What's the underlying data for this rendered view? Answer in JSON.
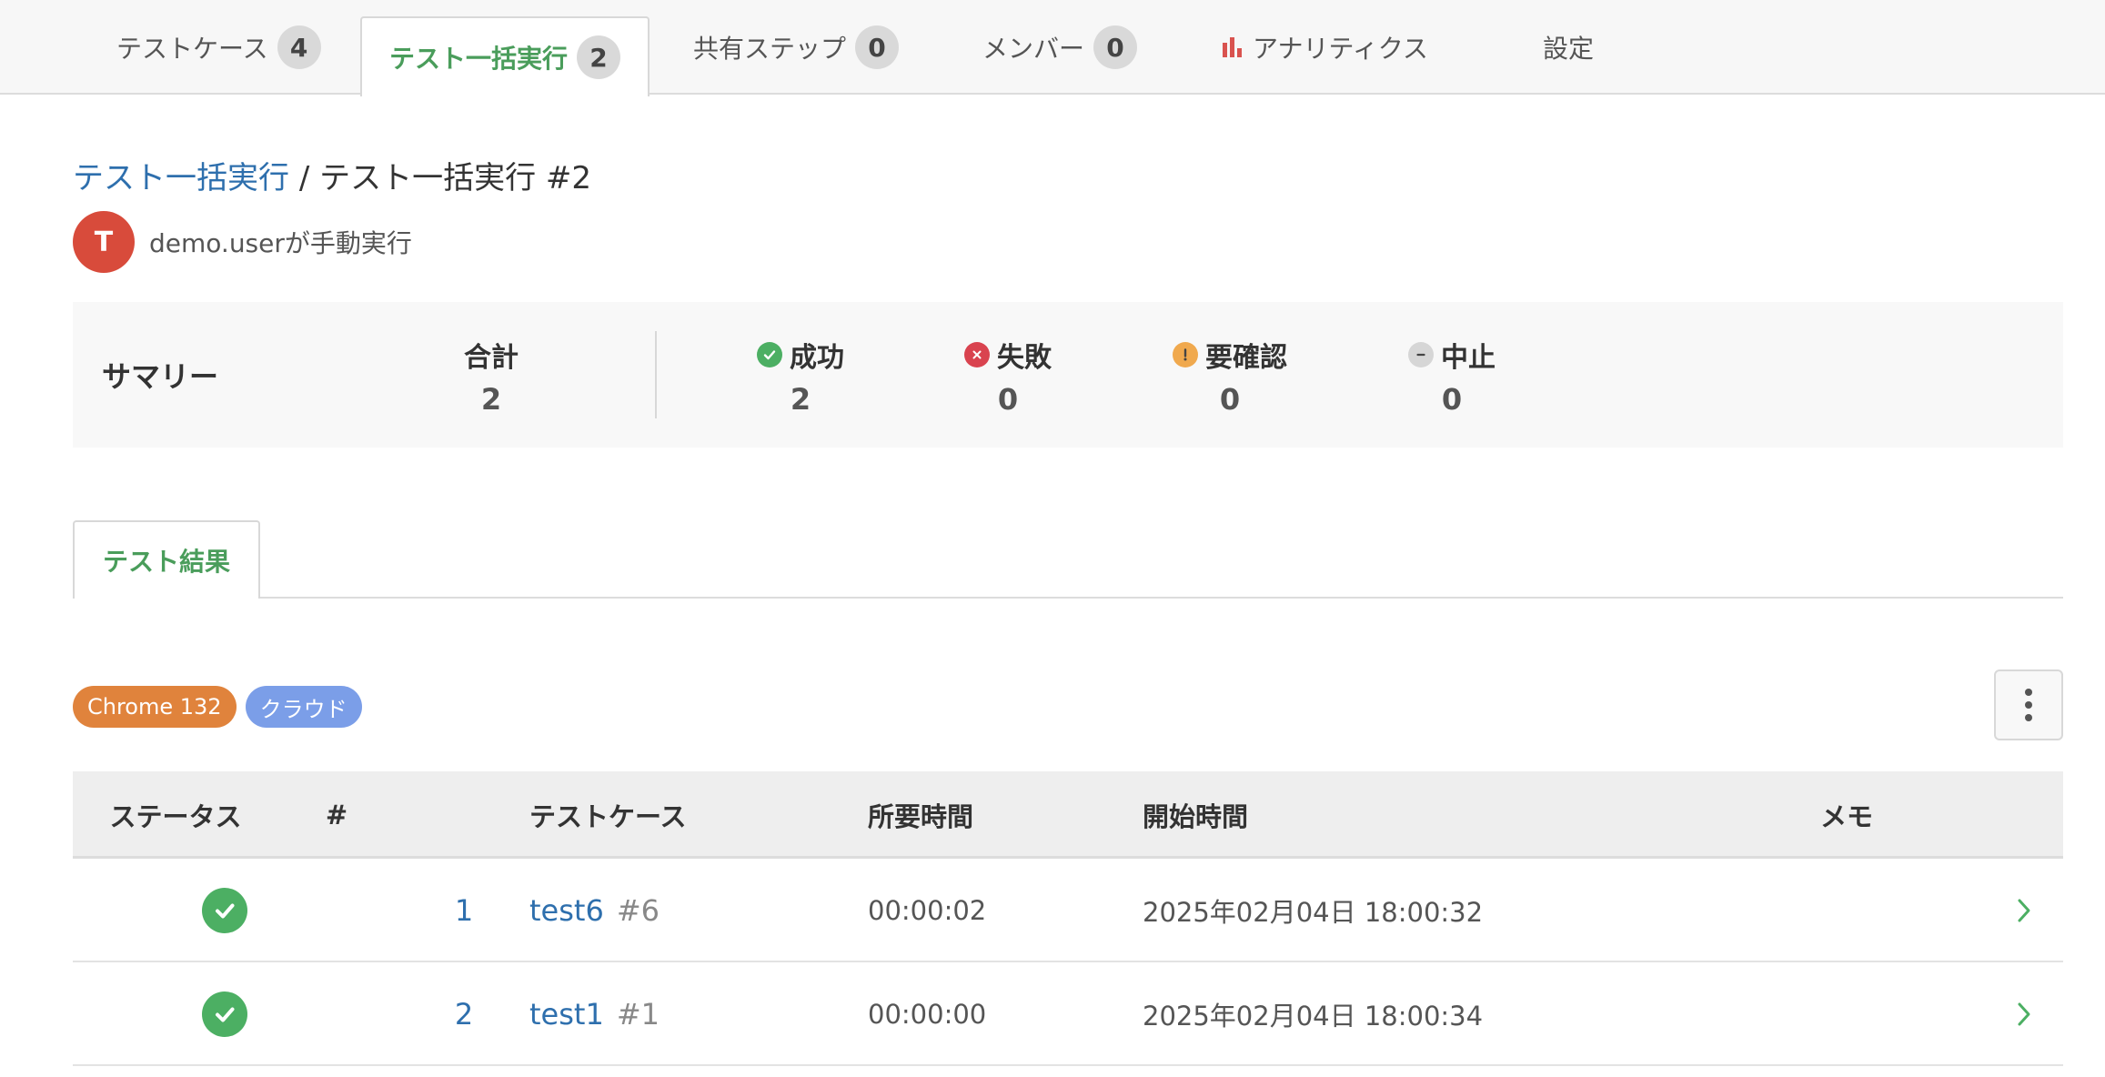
{
  "top_tabs": [
    {
      "label": "テストケース",
      "count": "4"
    },
    {
      "label": "テスト一括実行",
      "count": "2"
    },
    {
      "label": "共有ステップ",
      "count": "0"
    },
    {
      "label": "メンバー",
      "count": "0"
    },
    {
      "label": "アナリティクス",
      "icon": "bar-chart-icon"
    },
    {
      "label": "設定"
    }
  ],
  "breadcrumb": {
    "parent": "テスト一括実行",
    "separator": "/",
    "current": "テスト一括実行 #2"
  },
  "runner": {
    "avatar_initial": "T",
    "text": "demo.userが手動実行"
  },
  "summary": {
    "title": "サマリー",
    "total": {
      "label": "合計",
      "value": "2"
    },
    "success": {
      "label": "成功",
      "value": "2",
      "icon": "check-circle-icon"
    },
    "failed": {
      "label": "失敗",
      "value": "0",
      "icon": "x-circle-icon"
    },
    "review": {
      "label": "要確認",
      "value": "0",
      "icon": "exclamation-circle-icon"
    },
    "aborted": {
      "label": "中止",
      "value": "0",
      "icon": "minus-circle-icon"
    }
  },
  "results_tab": {
    "label": "テスト結果"
  },
  "tags": {
    "browser": "Chrome 132",
    "environment": "クラウド"
  },
  "table": {
    "headers": {
      "status": "ステータス",
      "number": "#",
      "test_case": "テストケース",
      "duration": "所要時間",
      "started": "開始時間",
      "memo": "メモ"
    },
    "rows": [
      {
        "status": "success",
        "number": "1",
        "name": "test6",
        "case_id": "#6",
        "duration": "00:00:02",
        "started": "2025年02月04日 18:00:32",
        "memo": ""
      },
      {
        "status": "success",
        "number": "2",
        "name": "test1",
        "case_id": "#1",
        "duration": "00:00:00",
        "started": "2025年02月04日 18:00:34",
        "memo": ""
      }
    ]
  },
  "colors": {
    "accent_green": "#4a9d5b",
    "link_blue": "#2e6fad",
    "success": "#4caf63",
    "fail": "#d9434f",
    "review": "#f0a94e",
    "avatar": "#d84b3b",
    "tag_browser": "#e0833c",
    "tag_env": "#7b9ee8"
  }
}
